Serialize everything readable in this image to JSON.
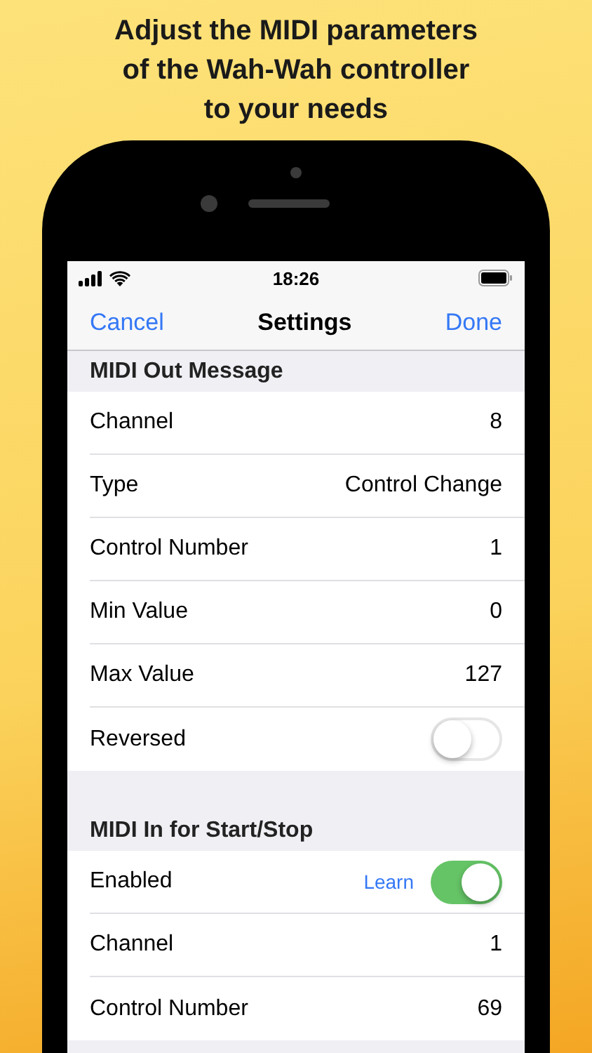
{
  "headline": "Adjust the MIDI parameters of the Wah-Wah controller to your needs",
  "status_bar": {
    "time": "18:26"
  },
  "nav_bar": {
    "left": "Cancel",
    "title": "Settings",
    "right": "Done"
  },
  "sections": [
    {
      "header": "MIDI Out Message",
      "rows": [
        {
          "kind": "value",
          "label": "Channel",
          "value": "8"
        },
        {
          "kind": "value",
          "label": "Type",
          "value": "Control Change"
        },
        {
          "kind": "value",
          "label": "Control Number",
          "value": "1"
        },
        {
          "kind": "value",
          "label": "Min Value",
          "value": "0"
        },
        {
          "kind": "value",
          "label": "Max Value",
          "value": "127"
        },
        {
          "kind": "toggle",
          "label": "Reversed",
          "on": false
        }
      ]
    },
    {
      "header": "MIDI In for Start/Stop",
      "rows": [
        {
          "kind": "toggle",
          "label": "Enabled",
          "on": true,
          "action": "Learn"
        },
        {
          "kind": "value",
          "label": "Channel",
          "value": "1"
        },
        {
          "kind": "value",
          "label": "Control Number",
          "value": "69"
        }
      ]
    }
  ]
}
